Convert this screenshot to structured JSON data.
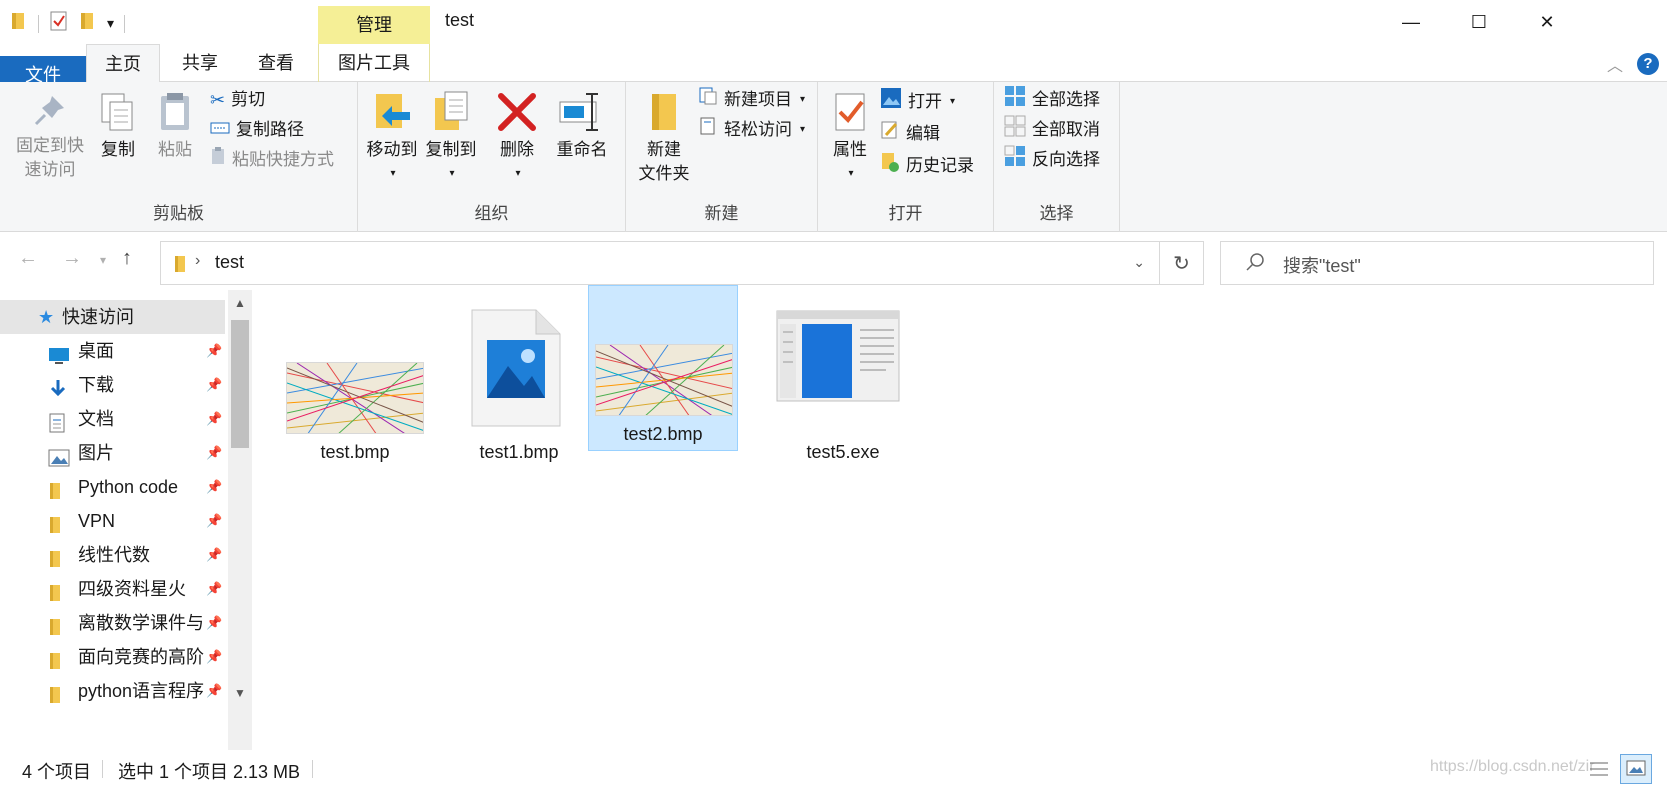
{
  "window": {
    "title": "test",
    "context_tab": "管理",
    "controls": {
      "minimize": "—",
      "maximize": "☐",
      "close": "✕"
    }
  },
  "tabs": [
    {
      "label": "文件"
    },
    {
      "label": "主页"
    },
    {
      "label": "共享"
    },
    {
      "label": "查看"
    },
    {
      "label": "图片工具"
    }
  ],
  "ribbon": {
    "clipboard": {
      "label": "剪贴板",
      "pin_line1": "固定到快",
      "pin_line2": "速访问",
      "copy": "复制",
      "paste": "粘贴",
      "cut": "剪切",
      "copy_path": "复制路径",
      "paste_shortcut": "粘贴快捷方式"
    },
    "organize": {
      "label": "组织",
      "move_to": "移动到",
      "copy_to": "复制到",
      "delete": "删除",
      "rename": "重命名"
    },
    "new": {
      "label": "新建",
      "new_folder_line1": "新建",
      "new_folder_line2": "文件夹",
      "new_item": "新建项目",
      "easy_access": "轻松访问"
    },
    "open": {
      "label": "打开",
      "properties": "属性",
      "open": "打开",
      "edit": "编辑",
      "history": "历史记录"
    },
    "select": {
      "label": "选择",
      "select_all": "全部选择",
      "select_none": "全部取消",
      "invert": "反向选择"
    }
  },
  "address": {
    "path": "test",
    "search_placeholder": "搜索\"test\""
  },
  "nav": {
    "quick_access": "快速访问",
    "items": [
      {
        "label": "桌面"
      },
      {
        "label": "下载"
      },
      {
        "label": "文档"
      },
      {
        "label": "图片"
      },
      {
        "label": "Python code"
      },
      {
        "label": "VPN"
      },
      {
        "label": "线性代数"
      },
      {
        "label": "四级资料星火"
      },
      {
        "label": "离散数学课件与"
      },
      {
        "label": "面向竞赛的高阶"
      },
      {
        "label": "python语言程序"
      }
    ]
  },
  "files": [
    {
      "name": "test.bmp"
    },
    {
      "name": "test1.bmp"
    },
    {
      "name": "test2.bmp"
    },
    {
      "name": "test5.exe"
    }
  ],
  "status": {
    "count": "4 个项目",
    "selection": "选中 1 个项目  2.13 MB",
    "watermark": "https://blog.csdn.net/zir"
  },
  "colors": {
    "accent": "#1a6bbf",
    "context_tab": "#f5ef96",
    "selection": "#cce8ff",
    "folder": "#f3c74f"
  }
}
